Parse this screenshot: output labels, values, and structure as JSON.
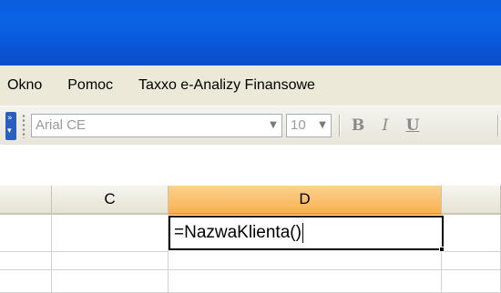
{
  "menu": {
    "items": [
      "Okno",
      "Pomoc",
      "Taxxo e-Analizy Finansowe"
    ]
  },
  "toolbar": {
    "font_name": "Arial CE",
    "font_size": "10",
    "bold_label": "B",
    "italic_label": "I",
    "underline_label": "U"
  },
  "sheet": {
    "columns": [
      "C",
      "D"
    ],
    "active_column": "D",
    "active_cell_value": "=NazwaKlienta()"
  },
  "colors": {
    "title_bar": "#0a5ee0",
    "menu_background": "#ece9d8",
    "active_header": "#f9b052"
  }
}
